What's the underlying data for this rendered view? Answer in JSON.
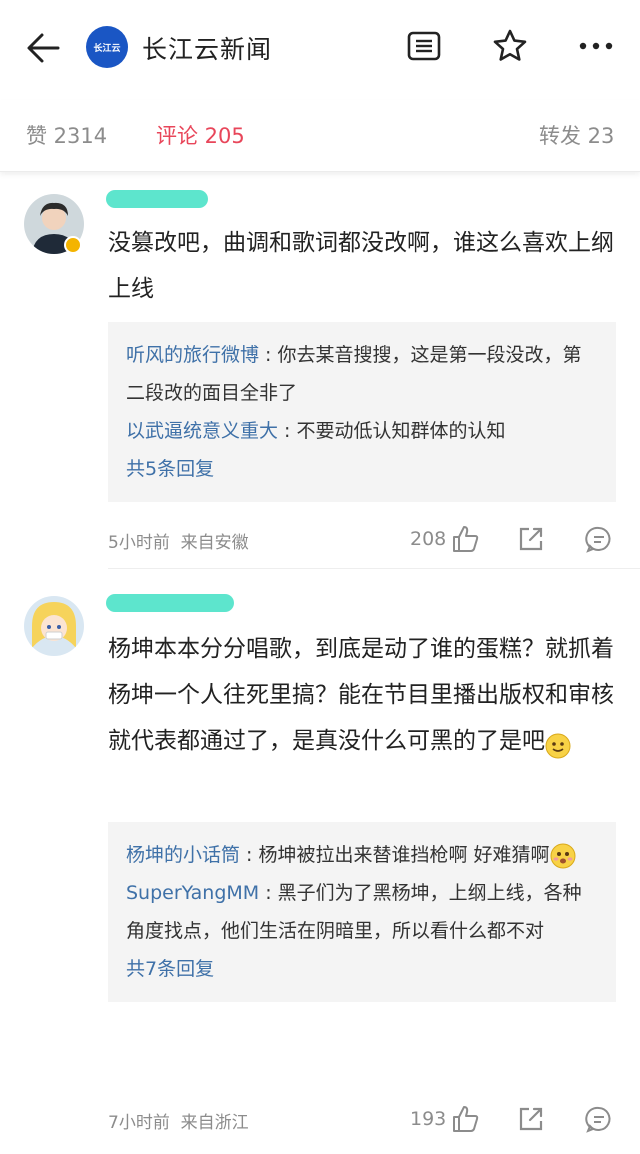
{
  "header": {
    "app_title": "长江云新闻",
    "logo_text": "长江云"
  },
  "stats": {
    "likes": "赞 2314",
    "comments": "评论 205",
    "shares": "转发 23"
  },
  "comments": [
    {
      "text": "没篡改吧，曲调和歌词都没改啊，谁这么喜欢上纲上线",
      "replies": [
        {
          "name": "听风的旅行微博",
          "text": "你去某音搜搜，这是第一段没改，第二段改的面目全非了"
        },
        {
          "name": "以武逼统意义重大",
          "text": "不要动低认知群体的认知"
        }
      ],
      "reply_count": "共5条回复",
      "time": "5小时前",
      "location": "来自安徽",
      "likes": "208"
    },
    {
      "text": "杨坤本本分分唱歌，到底是动了谁的蛋糕？就抓着杨坤一个人往死里搞？能在节目里播出版权和审核就代表都通过了，是真没什么可黑的了是吧",
      "replies": [
        {
          "name": "杨坤的小话筒",
          "text": "杨坤被拉出来替谁挡枪啊 好难猜啊"
        },
        {
          "name": "SuperYangMM",
          "text": "黑子们为了黑杨坤，上纲上线，各种角度找点，他们生活在阴暗里，所以看什么都不对"
        }
      ],
      "reply_count": "共7条回复",
      "time": "7小时前",
      "location": "来自浙江",
      "likes": "193"
    }
  ]
}
